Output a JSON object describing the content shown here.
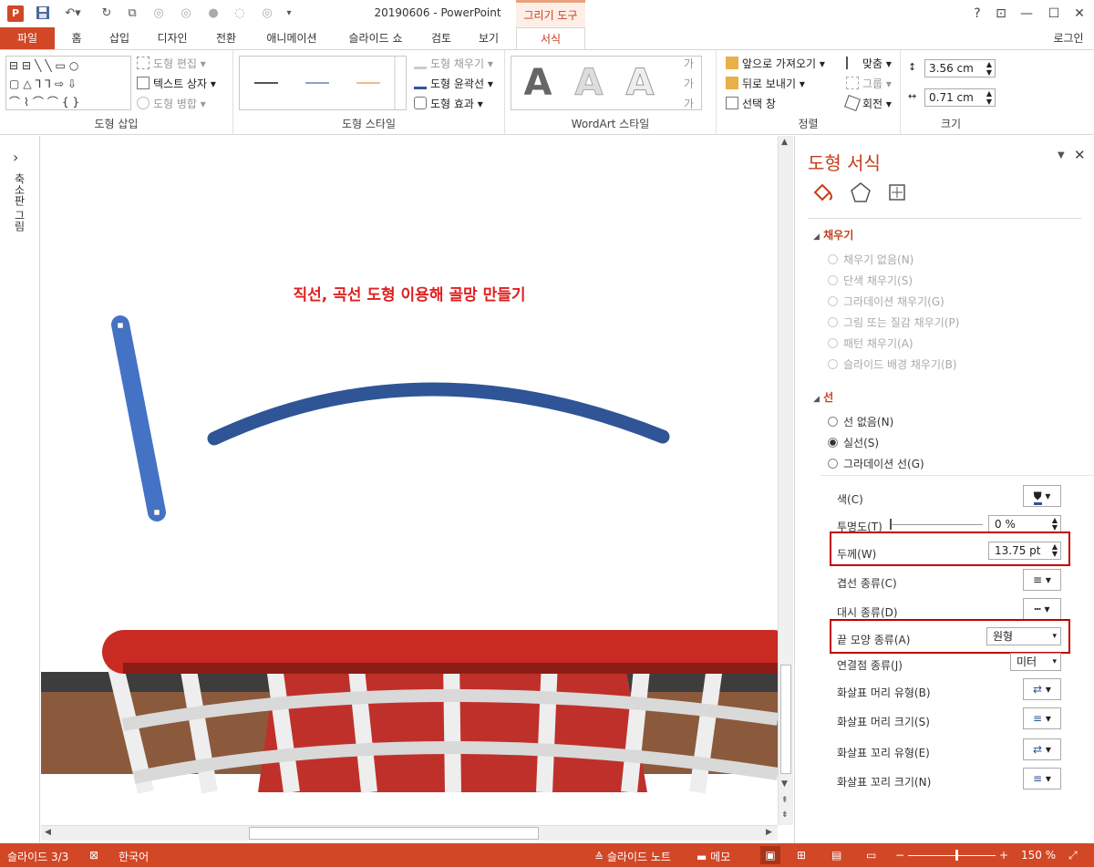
{
  "titlebar": {
    "app_icon": "P",
    "doc_title": "20190606 - PowerPoint",
    "tool_group": "그리기 도구",
    "help": "?",
    "restore_ribbon": "⊡",
    "minimize": "—",
    "maximize": "☐",
    "close": "✕"
  },
  "tabs": {
    "file": "파일",
    "home": "홈",
    "insert": "삽입",
    "design": "디자인",
    "transitions": "전환",
    "animations": "애니메이션",
    "slideshow": "슬라이드 쇼",
    "review": "검토",
    "view": "보기",
    "format": "서식",
    "login": "로그인"
  },
  "ribbon": {
    "insert_shapes": {
      "label": "도형 삽입",
      "edit_shape": "도형 편집",
      "text_box": "텍스트 상자",
      "merge_shapes": "도형 병합"
    },
    "shape_styles": {
      "label": "도형 스타일",
      "fill": "도형 채우기",
      "outline": "도형 윤곽선",
      "effects": "도형 효과"
    },
    "wordart": {
      "label": "WordArt 스타일",
      "letter": "A"
    },
    "arrange": {
      "label": "정렬",
      "bring_forward": "앞으로 가져오기",
      "send_backward": "뒤로 보내기",
      "selection_pane": "선택 창",
      "align": "맞춤",
      "group": "그룹",
      "rotate": "회전"
    },
    "size": {
      "label": "크기",
      "height": "3.56 cm",
      "width": "0.71 cm"
    }
  },
  "left_panel": {
    "label": "축소판 그림",
    "expand": "›"
  },
  "slide": {
    "title": "직선, 곡선 도형 이용해 골망 만들기"
  },
  "pane": {
    "title": "도형 서식",
    "fill_section": "채우기",
    "fill_options": [
      "채우기 없음(N)",
      "단색 채우기(S)",
      "그라데이션 채우기(G)",
      "그림 또는 질감 채우기(P)",
      "패턴 채우기(A)",
      "슬라이드 배경 채우기(B)"
    ],
    "line_section": "선",
    "line_options": [
      "선 없음(N)",
      "실선(S)",
      "그라데이션 선(G)"
    ],
    "props": {
      "color": "색(C)",
      "transparency": "투명도(T)",
      "transparency_value": "0 %",
      "width": "두께(W)",
      "width_value": "13.75 pt",
      "compound": "겹선 종류(C)",
      "dash": "대시 종류(D)",
      "cap": "끝 모양 종류(A)",
      "cap_value": "원형",
      "join": "연결점 종류(J)",
      "join_value": "미터",
      "begin_arrow_type": "화살표 머리 유형(B)",
      "begin_arrow_size": "화살표 머리 크기(S)",
      "end_arrow_type": "화살표 꼬리 유형(E)",
      "end_arrow_size": "화살표 꼬리 크기(N)"
    }
  },
  "status": {
    "slide": "슬라이드 3/3",
    "language": "한국어",
    "notes": "슬라이드 노트",
    "comments": "메모",
    "zoom": "150 %"
  },
  "colors": {
    "accent": "#d24726",
    "pane_title": "#c43e1c",
    "highlight_box": "#c00000",
    "straight_line": "#4472c4",
    "curve_line": "#2f5597",
    "title_text": "#e02020"
  }
}
